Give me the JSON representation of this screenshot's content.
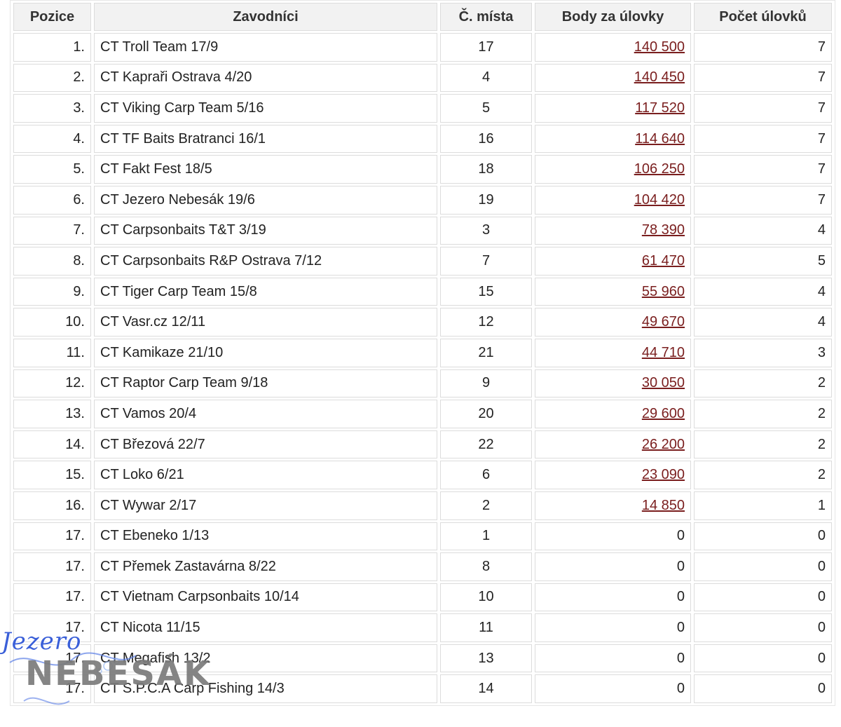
{
  "table": {
    "headers": [
      "Pozice",
      "Zavodníci",
      "Č. místa",
      "Body za úlovky",
      "Počet úlovků"
    ],
    "rows": [
      {
        "pos": "1.",
        "team": "CT Troll Team 17/9",
        "place": "17",
        "points": "140 500",
        "catches": "7"
      },
      {
        "pos": "2.",
        "team": "CT Kapraři Ostrava 4/20",
        "place": "4",
        "points": "140 450",
        "catches": "7"
      },
      {
        "pos": "3.",
        "team": "CT Viking Carp Team 5/16",
        "place": "5",
        "points": "117 520",
        "catches": "7"
      },
      {
        "pos": "4.",
        "team": "CT TF Baits Bratranci 16/1",
        "place": "16",
        "points": "114 640",
        "catches": "7"
      },
      {
        "pos": "5.",
        "team": "CT Fakt Fest 18/5",
        "place": "18",
        "points": "106 250",
        "catches": "7"
      },
      {
        "pos": "6.",
        "team": "CT Jezero Nebesák 19/6",
        "place": "19",
        "points": "104 420",
        "catches": "7"
      },
      {
        "pos": "7.",
        "team": "CT Carpsonbaits T&T 3/19",
        "place": "3",
        "points": "78 390",
        "catches": "4"
      },
      {
        "pos": "8.",
        "team": "CT Carpsonbaits R&P Ostrava 7/12",
        "place": "7",
        "points": "61 470",
        "catches": "5"
      },
      {
        "pos": "9.",
        "team": "CT Tiger Carp Team 15/8",
        "place": "15",
        "points": "55 960",
        "catches": "4"
      },
      {
        "pos": "10.",
        "team": "CT Vasr.cz 12/11",
        "place": "12",
        "points": "49 670",
        "catches": "4"
      },
      {
        "pos": "11.",
        "team": "CT Kamikaze 21/10",
        "place": "21",
        "points": "44 710",
        "catches": "3"
      },
      {
        "pos": "12.",
        "team": "CT Raptor Carp Team 9/18",
        "place": "9",
        "points": "30 050",
        "catches": "2"
      },
      {
        "pos": "13.",
        "team": "CT Vamos 20/4",
        "place": "20",
        "points": "29 600",
        "catches": "2"
      },
      {
        "pos": "14.",
        "team": "CT Březová 22/7",
        "place": "22",
        "points": "26 200",
        "catches": "2"
      },
      {
        "pos": "15.",
        "team": "CT Loko 6/21",
        "place": "6",
        "points": "23 090",
        "catches": "2"
      },
      {
        "pos": "16.",
        "team": "CT Wywar 2/17",
        "place": "2",
        "points": "14 850",
        "catches": "1"
      },
      {
        "pos": "17.",
        "team": "CT Ebeneko 1/13",
        "place": "1",
        "points": "0",
        "catches": "0"
      },
      {
        "pos": "17.",
        "team": "CT Přemek Zastavárna 8/22",
        "place": "8",
        "points": "0",
        "catches": "0"
      },
      {
        "pos": "17.",
        "team": "CT Vietnam Carpsonbaits 10/14",
        "place": "10",
        "points": "0",
        "catches": "0"
      },
      {
        "pos": "17.",
        "team": "CT Nicota 11/15",
        "place": "11",
        "points": "0",
        "catches": "0"
      },
      {
        "pos": "17.",
        "team": "CT Megafish 13/2",
        "place": "13",
        "points": "0",
        "catches": "0"
      },
      {
        "pos": "17.",
        "team": "CT S.P.C.A Carp Fishing 14/3",
        "place": "14",
        "points": "0",
        "catches": "0"
      }
    ]
  },
  "watermark": {
    "script_text": "Jezero",
    "main_text": "NEBESÁK"
  },
  "colors": {
    "link": "#7a1e1e",
    "header_bg": "#f2f2f2",
    "border": "#dcdcdc",
    "watermark_blue": "#3a5fd8",
    "watermark_grey": "#7b7b7b"
  }
}
